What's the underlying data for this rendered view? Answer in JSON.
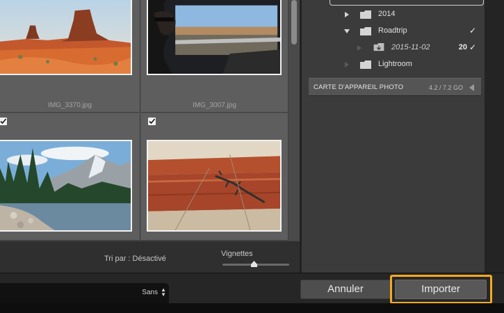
{
  "grid": {
    "photos": [
      {
        "filename": "IMG_3370.jpg",
        "checked": false,
        "subject": "desert mesas"
      },
      {
        "filename": "IMG_3007.jpg",
        "checked": false,
        "subject": "person in car"
      },
      {
        "filename": "",
        "checked": true,
        "subject": "mountain lake with pines"
      },
      {
        "filename": "",
        "checked": true,
        "subject": "lizard on wooden rail"
      }
    ],
    "toolbar": {
      "sort_label": "Tri par : Désactivé",
      "thumbnails_label": "Vignettes",
      "thumbnail_size_level": 0.47
    }
  },
  "tree": {
    "items": [
      {
        "label": "2014",
        "expanded": false,
        "count": "",
        "checked": false
      },
      {
        "label": "Roadtrip",
        "expanded": true,
        "count": "",
        "checked": true
      },
      {
        "label": "2015-11-02",
        "expanded": false,
        "count": "20",
        "checked": true
      },
      {
        "label": "Lightroom",
        "expanded": false,
        "count": "",
        "checked": false
      }
    ]
  },
  "device": {
    "title": "CARTE D'APPAREIL PHOTO",
    "size": "4.2 / 7.2 GO"
  },
  "bottom": {
    "preset_label": "Sans",
    "cancel_label": "Annuler",
    "import_label": "Importer",
    "highlight_color": "#f2a922"
  }
}
